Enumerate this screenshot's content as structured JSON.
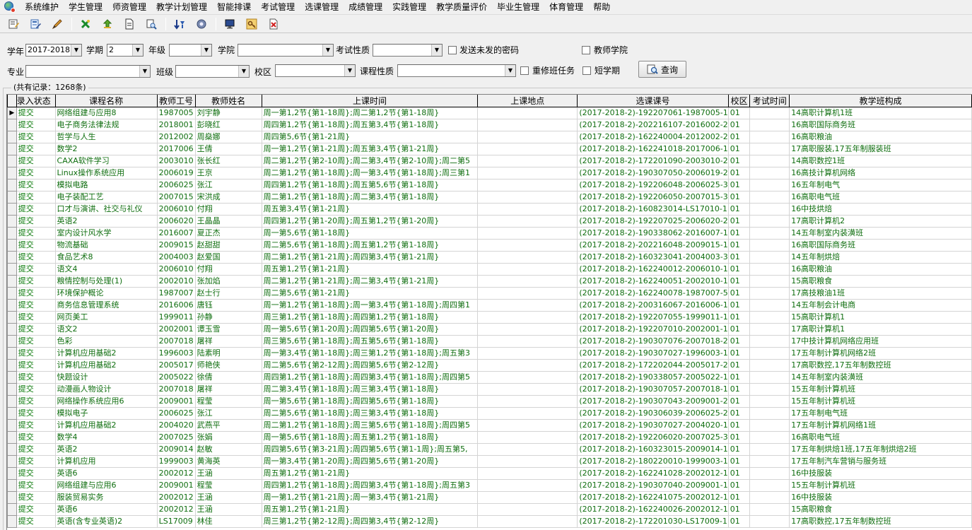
{
  "menubar": {
    "items": [
      "系统维护",
      "学生管理",
      "师资管理",
      "教学计划管理",
      "智能排课",
      "考试管理",
      "选课管理",
      "成绩管理",
      "实践管理",
      "教学质量评价",
      "毕业生管理",
      "体育管理",
      "帮助"
    ]
  },
  "toolbar": {
    "icons": [
      "edit-form-icon",
      "edit-doc-icon",
      "pencil-icon",
      "export-excel-icon",
      "import-icon",
      "page-icon",
      "print-preview-icon",
      "filter-sort-icon",
      "settings-gear-icon",
      "monitor-icon",
      "key-icon",
      "close-doc-icon"
    ]
  },
  "filters": {
    "xuenian_label": "学年",
    "xuenian_value": "2017-2018",
    "xueqi_label": "学期",
    "xueqi_value": "2",
    "nianji_label": "年级",
    "nianji_value": "",
    "xueyuan_label": "学院",
    "xueyuan_value": "",
    "kaoshi_label": "考试性质",
    "kaoshi_value": "",
    "send_pwd_label": "发送未发的密码",
    "teacher_college_label": "教师学院",
    "zhuanye_label": "专业",
    "zhuanye_value": "",
    "banji_label": "班级",
    "banji_value": "",
    "xiaoqu_label": "校区",
    "xiaoqu_value": "",
    "kecheng_label": "课程性质",
    "kecheng_value": "",
    "rebuild_label": "重修班任务",
    "short_term_label": "短学期",
    "query_label": "查询"
  },
  "grid": {
    "caption": "(共有记录：1268条)",
    "columns": [
      "录入状态",
      "课程名称",
      "教师工号",
      "教师姓名",
      "上课时间",
      "上课地点",
      "选课课号",
      "校区",
      "考试时间",
      "教学班构成"
    ],
    "rows": [
      [
        "提交",
        "网络组建与应用8",
        "1987005",
        "刘宇静",
        "周一第1,2节{第1-18周};周二第1,2节{第1-18周}",
        "",
        "(2017-2018-2)-192207061-1987005-1",
        "01",
        "",
        "14高职计算机1班"
      ],
      [
        "提交",
        "电子商务法律法规",
        "2018001",
        "彭晓红",
        "周四第1,2节{第1-18周};周五第3,4节{第1-18周}",
        "",
        "(2017-2018-2)-202216107-2016002-2",
        "01",
        "",
        "16高职国际商务班"
      ],
      [
        "提交",
        "哲学与人生",
        "2012002",
        "周燊娜",
        "周四第5,6节{第1-21周}",
        "",
        "(2017-2018-2)-162240004-2012002-2",
        "01",
        "",
        "16高职粮油"
      ],
      [
        "提交",
        "数学2",
        "2017006",
        "王倩",
        "周一第1,2节{第1-21周};周五第3,4节{第1-21周}",
        "",
        "(2017-2018-2)-162241018-2017006-1",
        "01",
        "",
        "17高职服装,17五年制服装班"
      ],
      [
        "提交",
        "CAXA软件学习",
        "2003010",
        "张长红",
        "周二第1,2节{第2-10周};周二第3,4节{第2-10周};周二第5",
        "",
        "(2017-2018-2)-172201090-2003010-2",
        "01",
        "",
        "14高职数控1班"
      ],
      [
        "提交",
        "Linux操作系统应用",
        "2006019",
        "王京",
        "周二第1,2节{第1-18周};周一第3,4节{第1-18周};周三第1",
        "",
        "(2017-2018-2)-190307050-2006019-2",
        "01",
        "",
        "16高技计算机网络"
      ],
      [
        "提交",
        "模拟电路",
        "2006025",
        "张江",
        "周四第1,2节{第1-18周};周五第5,6节{第1-18周}",
        "",
        "(2017-2018-2)-192206048-2006025-3",
        "01",
        "",
        "16五年制电气"
      ],
      [
        "提交",
        "电子装配工艺",
        "2007015",
        "宋洪成",
        "周二第1,2节{第1-18周};周二第3,4节{第1-18周}",
        "",
        "(2017-2018-2)-192206050-2007015-3",
        "01",
        "",
        "16高职电气班"
      ],
      [
        "提交",
        "口才与演讲、社交与礼仪",
        "2006010",
        "付翔",
        "周五第3,4节{第1-21周}",
        "",
        "(2017-2018-2)-160823014-LS17010-1",
        "01",
        "",
        "16中技烘焙"
      ],
      [
        "提交",
        "英语2",
        "2006020",
        "王晶晶",
        "周四第1,2节{第1-20周};周五第1,2节{第1-20周}",
        "",
        "(2017-2018-2)-192207025-2006020-2",
        "01",
        "",
        "17高职计算机2"
      ],
      [
        "提交",
        "室内设计风水学",
        "2016007",
        "夏正杰",
        "周一第5,6节{第1-18周}",
        "",
        "(2017-2018-2)-190338062-2016007-1",
        "01",
        "",
        "14五年制室内装潢班"
      ],
      [
        "提交",
        "物流基础",
        "2009015",
        "赵甜甜",
        "周二第5,6节{第1-18周};周五第1,2节{第1-18周}",
        "",
        "(2017-2018-2)-202216048-2009015-1",
        "01",
        "",
        "16高职国际商务班"
      ],
      [
        "提交",
        "食品艺术8",
        "2004003",
        "赵爱国",
        "周二第1,2节{第1-21周};周四第3,4节{第1-21周}",
        "",
        "(2017-2018-2)-160323041-2004003-3",
        "01",
        "",
        "14五年制烘焙"
      ],
      [
        "提交",
        "语文4",
        "2006010",
        "付翔",
        "周五第1,2节{第1-21周}",
        "",
        "(2017-2018-2)-162240012-2006010-1",
        "01",
        "",
        "16高职粮油"
      ],
      [
        "提交",
        "粮情控制与处理(1)",
        "2002010",
        "张加焰",
        "周二第1,2节{第1-21周};周二第3,4节{第1-21周}",
        "",
        "(2017-2018-2)-162240051-2002010-1",
        "01",
        "",
        "15高职粮食"
      ],
      [
        "提交",
        "环境保护概论",
        "1987007",
        "赵士行",
        "周二第5,6节{第1-21周}",
        "",
        "(2017-2018-2)-162240078-1987007-5",
        "01",
        "",
        "17高技粮油1班"
      ],
      [
        "提交",
        "商务信息管理系统",
        "2016006",
        "唐钰",
        "周一第1,2节{第1-18周};周一第3,4节{第1-18周};周四第1",
        "",
        "(2017-2018-2)-200316067-2016006-1",
        "01",
        "",
        "14五年制会计电商"
      ],
      [
        "提交",
        "网页美工",
        "1999011",
        "孙静",
        "周三第1,2节{第1-18周};周四第1,2节{第1-18周}",
        "",
        "(2017-2018-2)-192207055-1999011-1",
        "01",
        "",
        "15高职计算机1"
      ],
      [
        "提交",
        "语文2",
        "2002001",
        "谭玉雪",
        "周一第5,6节{第1-20周};周四第5,6节{第1-20周}",
        "",
        "(2017-2018-2)-192207010-2002001-1",
        "01",
        "",
        "17高职计算机1"
      ],
      [
        "提交",
        "色彩",
        "2007018",
        "屠祥",
        "周三第5,6节{第1-18周};周五第5,6节{第1-18周}",
        "",
        "(2017-2018-2)-190307076-2007018-2",
        "01",
        "",
        "17中技计算机网络应用班"
      ],
      [
        "提交",
        "计算机应用基础2",
        "1996003",
        "陆素明",
        "周一第3,4节{第1-18周};周三第1,2节{第1-18周};周五第3",
        "",
        "(2017-2018-2)-190307027-1996003-1",
        "01",
        "",
        "17五年制计算机网络2班"
      ],
      [
        "提交",
        "计算机应用基础2",
        "2005017",
        "师艳侠",
        "周二第5,6节{第2-12周};周四第5,6节{第2-12周}",
        "",
        "(2017-2018-2)-172202044-2005017-2",
        "01",
        "",
        "17高职数控,17五年制数控班"
      ],
      [
        "提交",
        "快题设计",
        "2005022",
        "徐倩",
        "周四第1,2节{第1-18周};周四第3,4节{第1-18周};周四第5",
        "",
        "(2017-2018-2)-190338057-2005022-1",
        "01",
        "",
        "14五年制室内装潢班"
      ],
      [
        "提交",
        "动漫画人物设计",
        "2007018",
        "屠祥",
        "周二第3,4节{第1-18周};周三第3,4节{第1-18周}",
        "",
        "(2017-2018-2)-190307057-2007018-1",
        "01",
        "",
        "15五年制计算机班"
      ],
      [
        "提交",
        "网络操作系统应用6",
        "2009001",
        "程莹",
        "周一第5,6节{第1-18周};周四第5,6节{第1-18周}",
        "",
        "(2017-2018-2)-190307043-2009001-2",
        "01",
        "",
        "15五年制计算机班"
      ],
      [
        "提交",
        "模拟电子",
        "2006025",
        "张江",
        "周二第5,6节{第1-18周};周三第3,4节{第1-18周}",
        "",
        "(2017-2018-2)-190306039-2006025-2",
        "01",
        "",
        "17五年制电气班"
      ],
      [
        "提交",
        "计算机应用基础2",
        "2004020",
        "武燕平",
        "周二第1,2节{第1-18周};周三第5,6节{第1-18周};周四第5",
        "",
        "(2017-2018-2)-190307027-2004020-1",
        "01",
        "",
        "17五年制计算机网络1班"
      ],
      [
        "提交",
        "数学4",
        "2007025",
        "张娟",
        "周一第5,6节{第1-18周};周五第1,2节{第1-18周}",
        "",
        "(2017-2018-2)-192206020-2007025-3",
        "01",
        "",
        "16高职电气班"
      ],
      [
        "提交",
        "英语2",
        "2009014",
        "赵敏",
        "周四第5,6节{第3-21周};周四第5,6节{第1-1周};周五第5,",
        "",
        "(2017-2018-2)-160323015-2009014-1",
        "01",
        "",
        "17五年制烘焙1班,17五年制烘焙2班"
      ],
      [
        "提交",
        "计算机应用",
        "1999003",
        "黄海英",
        "周一第3,4节{第1-20周};周四第5,6节{第1-20周}",
        "",
        "(2017-2018-2)-180220010-1999003-1",
        "01",
        "",
        "17五年制汽车营销与服务班"
      ],
      [
        "提交",
        "英语6",
        "2002012",
        "王涵",
        "周五第1,2节{第1-21周}",
        "",
        "(2017-2018-2)-162241028-2002012-1",
        "01",
        "",
        "16中技服装"
      ],
      [
        "提交",
        "网络组建与应用6",
        "2009001",
        "程莹",
        "周四第1,2节{第1-18周};周四第3,4节{第1-18周};周五第3",
        "",
        "(2017-2018-2)-190307040-2009001-1",
        "01",
        "",
        "15五年制计算机班"
      ],
      [
        "提交",
        "服装贸易实务",
        "2002012",
        "王涵",
        "周一第1,2节{第1-21周};周一第3,4节{第1-21周}",
        "",
        "(2017-2018-2)-162241075-2002012-1",
        "01",
        "",
        "16中技服装"
      ],
      [
        "提交",
        "英语6",
        "2002012",
        "王涵",
        "周五第1,2节{第1-21周}",
        "",
        "(2017-2018-2)-162240026-2002012-1",
        "01",
        "",
        "15高职粮食"
      ],
      [
        "提交",
        "英语(含专业英语)2",
        "LS17009",
        "林佳",
        "周三第1,2节{第2-12周};周四第3,4节{第2-12周}",
        "",
        "(2017-2018-2)-172201030-LS17009-1",
        "01",
        "",
        "17高职数控,17五年制数控班"
      ]
    ]
  },
  "colors": {
    "cell_text": "#0f6e0f",
    "header_bg": "#f0f0f0",
    "window_bg": "#f0f0f0"
  }
}
